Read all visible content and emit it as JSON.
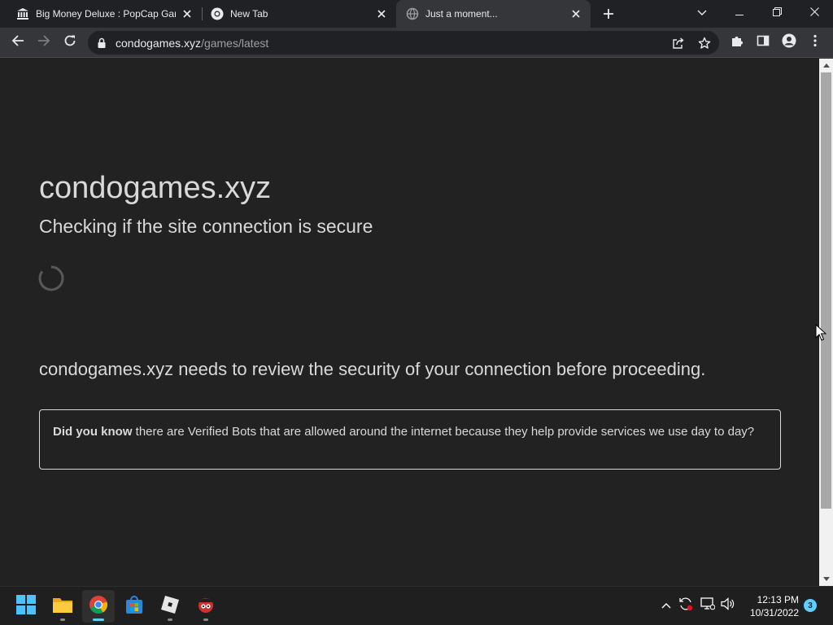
{
  "browser": {
    "tabs": [
      {
        "title": "Big Money Deluxe : PopCap Gam",
        "icon": "museum-icon",
        "active": false
      },
      {
        "title": "New Tab",
        "icon": "chrome-icon",
        "active": false
      },
      {
        "title": "Just a moment...",
        "icon": "globe-icon",
        "active": true
      }
    ],
    "address": {
      "host": "condogames.xyz",
      "path": "/games/latest"
    }
  },
  "page": {
    "site_title": "condogames.xyz",
    "subtitle": "Checking if the site connection is secure",
    "review_text": "condogames.xyz needs to review the security of your connection before proceeding.",
    "did_you_know_label": "Did you know",
    "did_you_know_text": " there are Verified Bots that are allowed around the internet because they help provide services we use day to day?"
  },
  "taskbar": {
    "apps": [
      "windows-start-icon",
      "file-explorer-icon",
      "chrome-icon",
      "microsoft-store-icon",
      "roblox-icon",
      "game-app-icon"
    ],
    "clock_time": "12:13 PM",
    "clock_date": "10/31/2022",
    "notification_count": "3"
  },
  "colors": {
    "page_background": "#222222",
    "tab_strip": "#202124",
    "toolbar": "#35363a",
    "accent": "#60cdff"
  }
}
